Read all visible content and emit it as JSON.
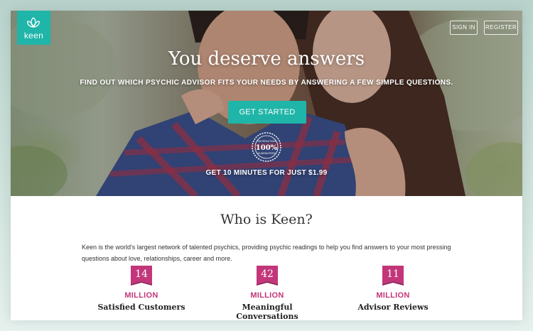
{
  "brand": {
    "name": "keen",
    "color": "#1fb5a8"
  },
  "header": {
    "sign_in": "SIGN IN",
    "register": "REGISTER"
  },
  "hero": {
    "title": "You deserve answers",
    "subtitle": "FIND OUT WHICH PSYCHIC ADVISOR FITS YOUR NEEDS BY ANSWERING A FEW SIMPLE QUESTIONS.",
    "cta": "GET STARTED",
    "seal": {
      "top": "SATISFACTION",
      "number": "100%",
      "bottom": "GUARANTEED"
    },
    "offer": "GET 10 MINUTES FOR JUST $1.99"
  },
  "about": {
    "title": "Who is Keen?",
    "description": "Keen is the world's largest network of talented psychics, providing psychic readings to help you find answers to your most pressing questions about love, relationships, career and more."
  },
  "stats": [
    {
      "value": "14",
      "unit": "MILLION",
      "label": "Satisfied Customers"
    },
    {
      "value": "42",
      "unit": "MILLION",
      "label": "Meaningful Conversations"
    },
    {
      "value": "11",
      "unit": "MILLION",
      "label": "Advisor Reviews"
    }
  ],
  "colors": {
    "accent": "#1fb5a8",
    "stat": "#c3367a",
    "text": "#333333"
  }
}
